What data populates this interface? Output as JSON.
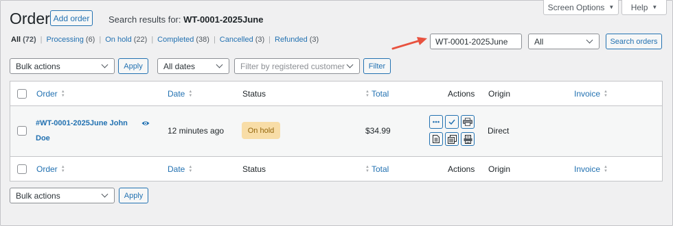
{
  "header": {
    "title": "Orders",
    "add_order_label": "Add order",
    "search_prefix": "Search results for:",
    "search_term": "WT-0001-2025June"
  },
  "screen_tabs": {
    "screen_options_label": "Screen Options",
    "help_label": "Help"
  },
  "status_links": [
    {
      "label": "All",
      "count": "(72)"
    },
    {
      "label": "Processing",
      "count": "(6)"
    },
    {
      "label": "On hold",
      "count": "(22)"
    },
    {
      "label": "Completed",
      "count": "(38)"
    },
    {
      "label": "Cancelled",
      "count": "(3)"
    },
    {
      "label": "Refunded",
      "count": "(3)"
    }
  ],
  "search": {
    "value": "WT-0001-2025June",
    "status_filter": "All",
    "button_label": "Search orders"
  },
  "filters_top": {
    "bulk_actions": "Bulk actions",
    "apply_label": "Apply",
    "dates": "All dates",
    "customer_placeholder": "Filter by registered customer",
    "filter_label": "Filter"
  },
  "filters_bottom": {
    "bulk_actions": "Bulk actions",
    "apply_label": "Apply"
  },
  "table": {
    "columns": {
      "order": "Order",
      "date": "Date",
      "status": "Status",
      "total": "Total",
      "actions": "Actions",
      "origin": "Origin",
      "invoice": "Invoice"
    },
    "rows": [
      {
        "order": "#WT-0001-2025June John Doe",
        "date": "12 minutes ago",
        "status": "On hold",
        "total": "$34.99",
        "origin": "Direct"
      }
    ]
  },
  "icons": {
    "preview": "eye-icon",
    "more_actions": "ellipsis-icon",
    "complete": "checkmark-icon",
    "print": "printer-icon",
    "invoice": "document-icon",
    "packing_slip": "document-stack-icon",
    "shipping_label": "shipping-label-icon"
  },
  "colors": {
    "accent": "#2271b1",
    "on_hold_bg": "#f8dda7",
    "on_hold_text": "#94660c",
    "annotation_arrow": "#e8523f"
  }
}
